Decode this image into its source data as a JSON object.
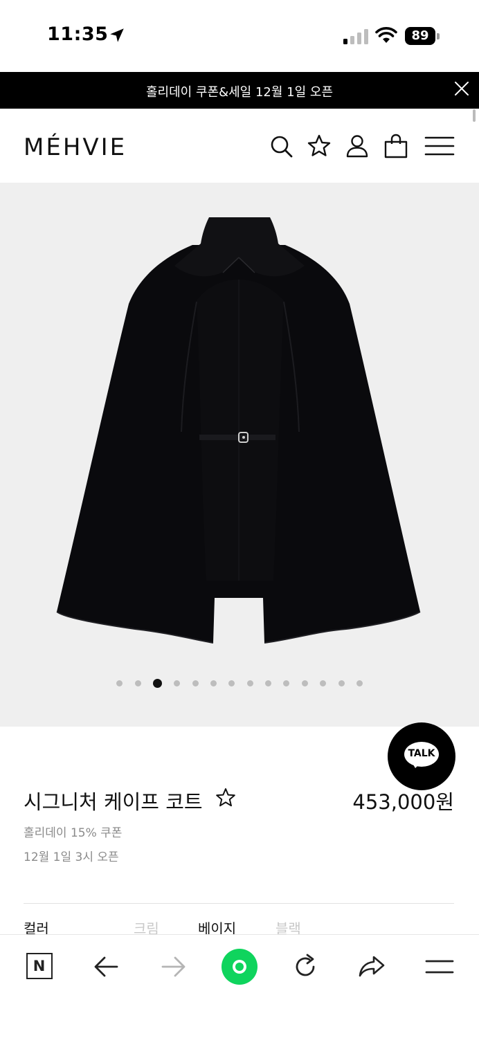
{
  "status_bar": {
    "time": "11:35",
    "battery": "89"
  },
  "promo": {
    "text": "홀리데이 쿠폰&세일 12월 1일 오픈"
  },
  "header": {
    "logo": "MÉHVIE"
  },
  "gallery": {
    "slide_count": 14,
    "active_slide": 3
  },
  "talk_button": {
    "label": "TALK"
  },
  "product": {
    "name": "시그니처 케이프 코트",
    "price": "453,000원",
    "coupon_note": "홀리데이 15% 쿠폰",
    "open_note": "12월 1일 3시 오픈"
  },
  "options": {
    "label": "컬러",
    "colors": [
      {
        "name": "크림",
        "available": false
      },
      {
        "name": "베이지",
        "available": true
      },
      {
        "name": "블랙",
        "available": false
      }
    ]
  },
  "icons": {
    "promo_close": "close-icon",
    "header": [
      "search-icon",
      "star-icon",
      "user-icon",
      "shopping-bag-icon",
      "menu-icon"
    ],
    "bottom_bar": [
      "naver-icon",
      "back-arrow-icon",
      "forward-arrow-icon",
      "green-dot-icon",
      "refresh-icon",
      "share-icon",
      "menu-icon"
    ]
  },
  "colors": {
    "banner_bg": "#000000",
    "gallery_bg": "#efefef",
    "accent_green": "#0fd45d",
    "muted_text": "#8a8a8a",
    "disabled_option": "#c8c8c8"
  }
}
